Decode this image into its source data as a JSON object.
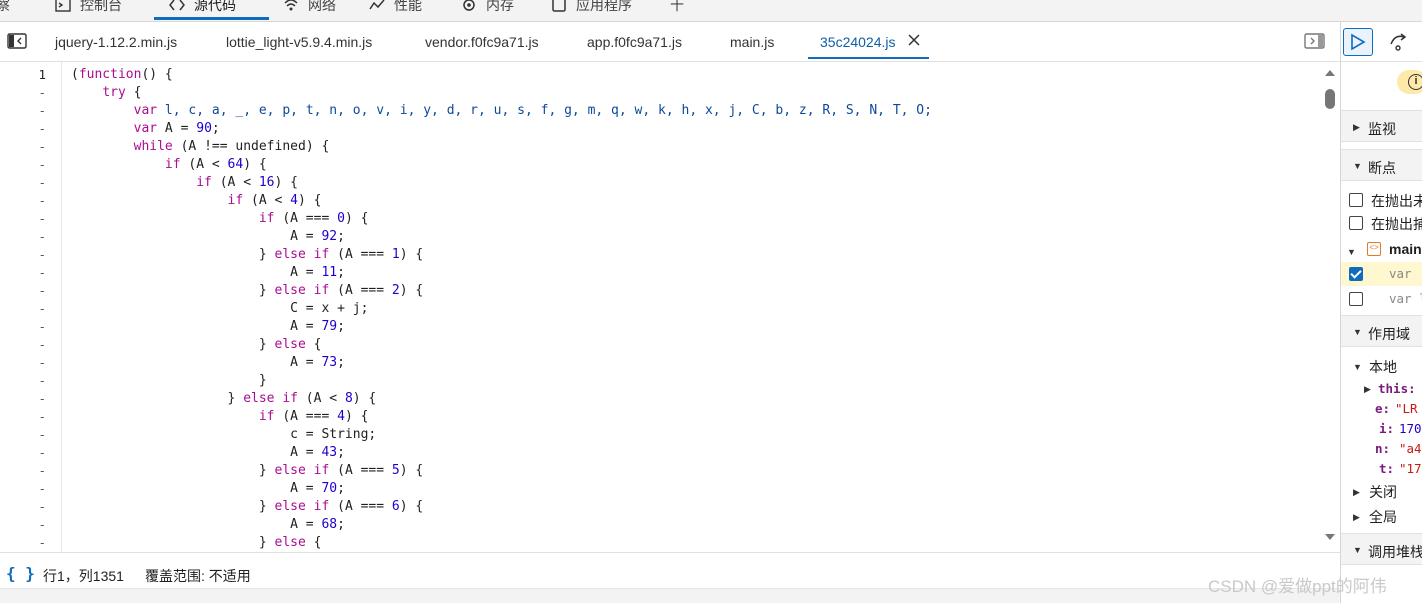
{
  "top_tabs": [
    {
      "label": "察",
      "icon": "partial"
    },
    {
      "label": "控制台",
      "icon": "console-icon"
    },
    {
      "label": "源代码",
      "icon": "sources-icon",
      "active": true
    },
    {
      "label": "网络",
      "icon": "wifi-icon"
    },
    {
      "label": "性能",
      "icon": "performance-icon"
    },
    {
      "label": "内存",
      "icon": "memory-icon"
    },
    {
      "label": "应用程序",
      "icon": "application-icon"
    },
    {
      "label": "十",
      "icon": "plus-icon"
    }
  ],
  "file_tabs": [
    {
      "label": "jquery-1.12.2.min.js"
    },
    {
      "label": "lottie_light-v5.9.4.min.js"
    },
    {
      "label": "vendor.f0fc9a71.js"
    },
    {
      "label": "app.f0fc9a71.js"
    },
    {
      "label": "main.js"
    },
    {
      "label": "35c24024.js",
      "active": true
    }
  ],
  "gutter": [
    "1",
    "-",
    "-",
    "-",
    "-",
    "-",
    "-",
    "-",
    "-",
    "-",
    "-",
    "-",
    "-",
    "-",
    "-",
    "-",
    "-",
    "-",
    "-",
    "-",
    "-",
    "-",
    "-",
    "-",
    "-",
    "-",
    "-"
  ],
  "code_lines": [
    "(function() {",
    "    try {",
    "        var l, c, a, _, e, p, t, n, o, v, i, y, d, r, u, s, f, g, m, q, w, k, h, x, j, C, b, z, R, S, N, T, O;",
    "        var A = 90;",
    "        while (A !== undefined) {",
    "            if (A < 64) {",
    "                if (A < 16) {",
    "                    if (A < 4) {",
    "                        if (A === 0) {",
    "                            A = 92;",
    "                        } else if (A === 1) {",
    "                            A = 11;",
    "                        } else if (A === 2) {",
    "                            C = x + j;",
    "                            A = 79;",
    "                        } else {",
    "                            A = 73;",
    "                        }",
    "                    } else if (A < 8) {",
    "                        if (A === 4) {",
    "                            c = String;",
    "                            A = 43;",
    "                        } else if (A === 5) {",
    "                            A = 70;",
    "                        } else if (A === 6) {",
    "                            A = 68;",
    "                        } else {"
  ],
  "status": {
    "braces": "{ }",
    "position": "行1，列1351",
    "coverage": "覆盖范围: 不适用"
  },
  "right_panel": {
    "watch": "监视",
    "breakpoints": "断点",
    "pause_uncaught": "在抛出未",
    "pause_caught": "在抛出捕",
    "bp_file": "main",
    "bp_line_1": "var",
    "bp_line_2": "var l",
    "scope": "作用域",
    "local": "本地",
    "this_key": "this:",
    "vars": [
      {
        "key": "e:",
        "val": "\"LR"
      },
      {
        "key": "i:",
        "val": "170"
      },
      {
        "key": "n:",
        "val": "\"a4"
      },
      {
        "key": "t:",
        "val": "\"17"
      }
    ],
    "closure": "关闭",
    "global": "全局",
    "call_stack": "调用堆栈"
  },
  "watermark": "CSDN @爱做ppt的阿伟",
  "colors": {
    "accent": "#0f6cbd",
    "keyword": "#aa0d91",
    "number": "#1c00cf"
  }
}
